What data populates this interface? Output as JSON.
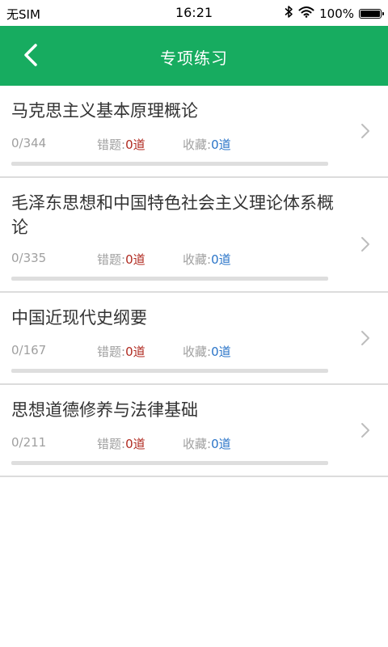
{
  "status_bar": {
    "carrier": "无SIM",
    "time": "16:21",
    "battery": "100%",
    "battery_level": 1.0,
    "icons": [
      "bluetooth-icon",
      "wifi-icon",
      "battery-icon"
    ]
  },
  "header": {
    "title": "专项练习",
    "back_icon": "chevron-left-icon",
    "background_color": "#17ac60"
  },
  "labels": {
    "errors": "错题:",
    "favorites": "收藏:"
  },
  "colors": {
    "error_value": "#b02a20",
    "favorite_value": "#2a74c8",
    "progress_track": "#dedede"
  },
  "subjects": [
    {
      "title": "马克思主义基本原理概论",
      "progress": "0/344",
      "done": 0,
      "total": 344,
      "errors": "0道",
      "favorites": "0道"
    },
    {
      "title": "毛泽东思想和中国特色社会主义理论体系概论",
      "progress": "0/335",
      "done": 0,
      "total": 335,
      "errors": "0道",
      "favorites": "0道"
    },
    {
      "title": "中国近现代史纲要",
      "progress": "0/167",
      "done": 0,
      "total": 167,
      "errors": "0道",
      "favorites": "0道"
    },
    {
      "title": "思想道德修养与法律基础",
      "progress": "0/211",
      "done": 0,
      "total": 211,
      "errors": "0道",
      "favorites": "0道"
    }
  ]
}
